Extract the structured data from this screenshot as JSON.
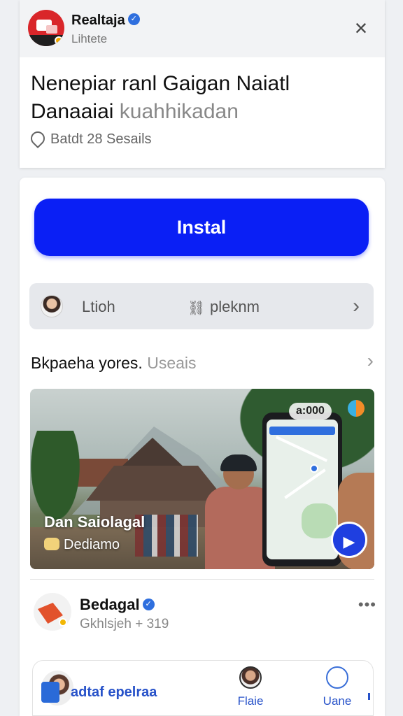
{
  "header": {
    "app_name": "Realtaja",
    "app_subtitle": "Lihtete",
    "headline_line1": "Nenepiar ranl Gaigan Naiatl",
    "headline_line2_strong": "Danaaiai",
    "headline_line2_muted": "kuahhikadan",
    "location": "Batdt 28 Sesails",
    "icons": {
      "app": "app-logo-icon",
      "verified": "verified-badge-icon",
      "close": "close-icon",
      "location": "location-pin-icon"
    }
  },
  "install": {
    "label": "Instal",
    "color": "#0a1ff5"
  },
  "contact_row": {
    "label": "Ltioh",
    "secondary_label": "pleknm",
    "icons": {
      "avatar": "avatar",
      "share": "share-icon",
      "chevron": "chevron-right-icon"
    }
  },
  "section": {
    "title_strong": "Bkpaeha yores.",
    "title_muted": "Useais"
  },
  "promo": {
    "status_text": "a:000",
    "title": "Dan Saiolagal",
    "subtitle": "Dediamo",
    "icons": {
      "play": "play-icon",
      "corner": "app-badge-icon"
    }
  },
  "advertiser": {
    "name": "Bedagal",
    "meta": "Gkhlsjeh + 319",
    "more": "•••"
  },
  "bottom_nav": {
    "brand": "adtaf epelraa",
    "items": [
      {
        "label": "Flaie",
        "icon": "profile-icon"
      },
      {
        "label": "Uane",
        "icon": "hand-icon"
      }
    ]
  }
}
